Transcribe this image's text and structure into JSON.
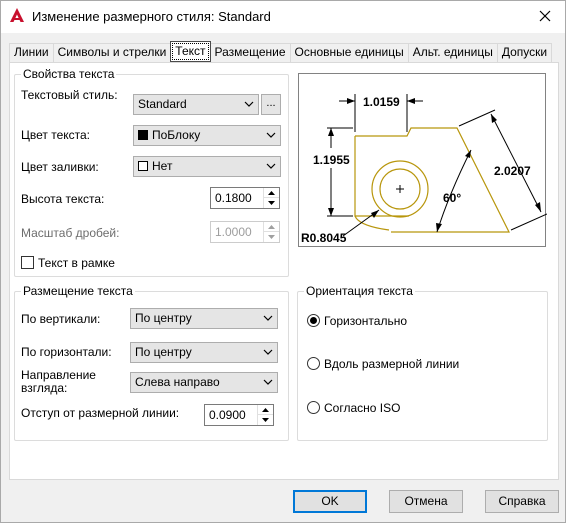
{
  "window": {
    "title": "Изменение размерного стиля: Standard",
    "icon": "autocad-a-icon",
    "accent": "#c8102e"
  },
  "tabs": [
    {
      "label": "Линии"
    },
    {
      "label": "Символы и стрелки"
    },
    {
      "label": "Текст",
      "active": true
    },
    {
      "label": "Размещение"
    },
    {
      "label": "Основные единицы"
    },
    {
      "label": "Альт. единицы"
    },
    {
      "label": "Допуски"
    }
  ],
  "text_properties": {
    "title": "Свойства текста",
    "style_label": "Текстовый стиль:",
    "style_value": "Standard",
    "style_button": "...",
    "color_label": "Цвет текста:",
    "color_value": "ПоБлоку",
    "fill_label": "Цвет заливки:",
    "fill_value": "Нет",
    "height_label": "Высота текста:",
    "height_value": "0.1800",
    "fraction_label": "Масштаб дробей:",
    "fraction_value": "1.0000",
    "frame_label": "Текст в рамке",
    "frame_checked": false
  },
  "text_placement": {
    "title": "Размещение текста",
    "vertical_label": "По вертикали:",
    "vertical_value": "По центру",
    "horizontal_label": "По горизонтали:",
    "horizontal_value": "По центру",
    "direction_label_1": "Направление",
    "direction_label_2": "взгляда:",
    "direction_value": "Слева направо",
    "offset_label": "Отступ от размерной линии:",
    "offset_value": "0.0900"
  },
  "text_alignment": {
    "title": "Ориентация текста",
    "options": [
      {
        "label": "Горизонтально",
        "selected": true
      },
      {
        "label": "Вдоль размерной линии",
        "selected": false
      },
      {
        "label": "Согласно ISO",
        "selected": false
      }
    ]
  },
  "preview": {
    "dim_top": "1.0159",
    "dim_left": "1.1955",
    "dim_right": "2.0207",
    "dim_angle": "60°",
    "dim_radius": "R0.8045",
    "geometry_color": "#b8960c"
  },
  "buttons": {
    "ok": "OK",
    "cancel": "Отмена",
    "help": "Справка"
  }
}
